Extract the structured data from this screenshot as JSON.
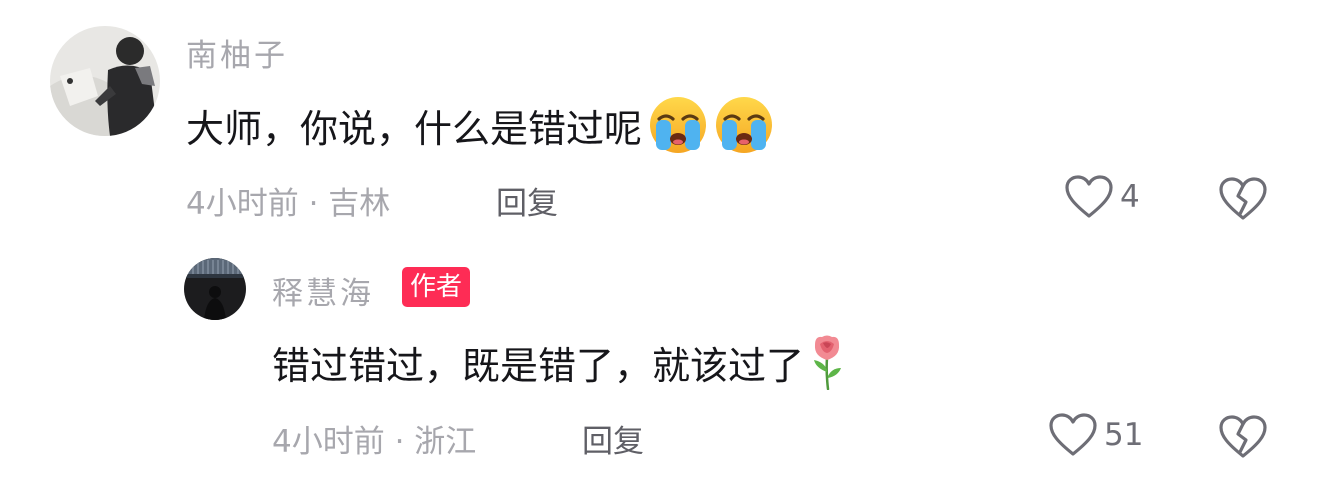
{
  "comment": {
    "username": "南柚子",
    "text": "大师，你说，什么是错过呢",
    "emojis": [
      "crying-face-emoji",
      "crying-face-emoji"
    ],
    "time": "4小时前",
    "location": "吉林",
    "reply_label": "回复",
    "like_count": "4"
  },
  "reply": {
    "username": "释慧海",
    "badge": "作者",
    "text": "错过错过，既是错了，就该过了",
    "emojis": [
      "rose-emoji"
    ],
    "time": "4小时前",
    "location": "浙江",
    "reply_label": "回复",
    "like_count": "51"
  },
  "colors": {
    "badge": "#fe2c55",
    "secondary_text": "#a7a7ad",
    "primary_text": "#16161a",
    "icon": "#6e6e76"
  }
}
